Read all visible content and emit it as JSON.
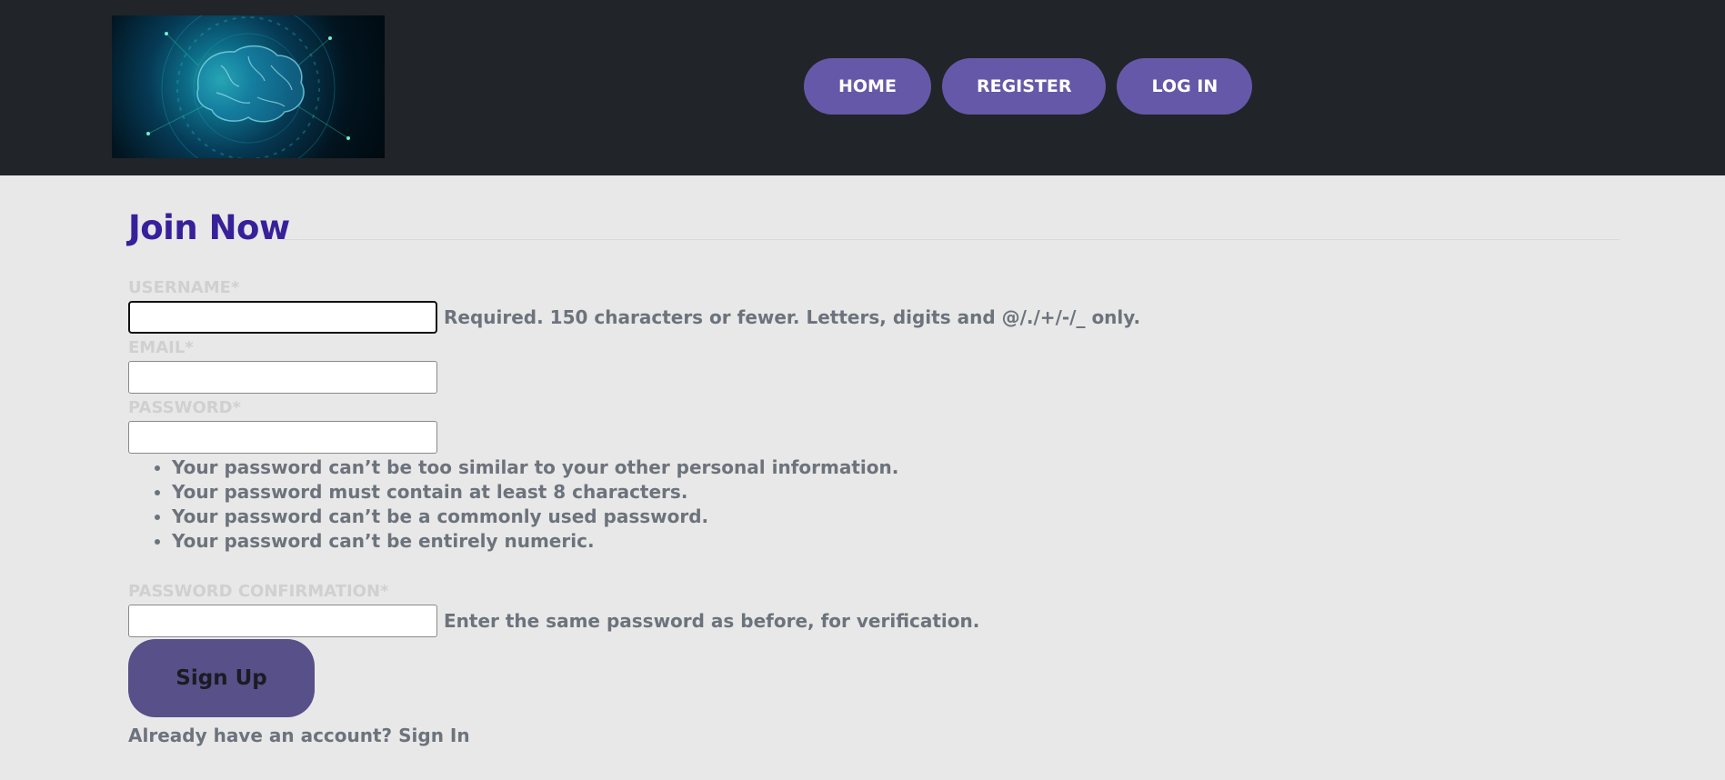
{
  "header": {
    "logo_icon": "brain-circuit-logo",
    "nav": [
      {
        "id": "home",
        "label": "HOME"
      },
      {
        "id": "register",
        "label": "REGISTER"
      },
      {
        "id": "login",
        "label": "LOG IN"
      }
    ],
    "background": "#212429",
    "button_color": "#6658a8"
  },
  "form": {
    "title": "Join Now",
    "title_color": "#38209a",
    "username": {
      "label": "USERNAME*",
      "value": "",
      "help": "Required. 150 characters or fewer. Letters, digits and @/./+/-/_ only."
    },
    "email": {
      "label": "EMAIL*",
      "value": ""
    },
    "password": {
      "label": "PASSWORD*",
      "value": "",
      "rules": [
        "Your password can’t be too similar to your other personal information.",
        "Your password must contain at least 8 characters.",
        "Your password can’t be a commonly used password.",
        "Your password can’t be entirely numeric."
      ]
    },
    "password_confirmation": {
      "label": "PASSWORD CONFIRMATION*",
      "value": "",
      "help": "Enter the same password as before, for verification."
    },
    "submit_label": "Sign Up",
    "already_text": "Already have an account?",
    "signin_label": "Sign In"
  }
}
